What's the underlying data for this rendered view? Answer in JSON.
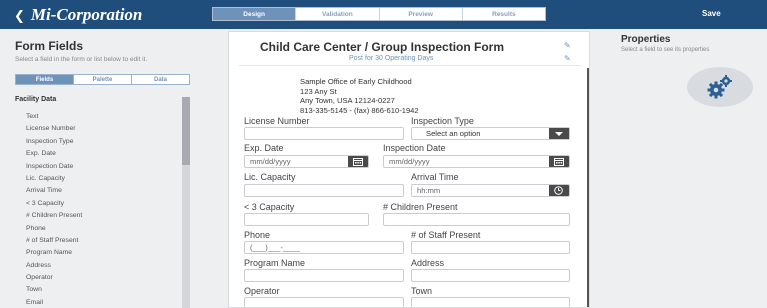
{
  "header": {
    "back_icon": "chevron-left-icon",
    "brand": "Mi-Corporation",
    "steps": [
      "Design",
      "Validation",
      "Preview",
      "Results"
    ],
    "active_step": "Design",
    "save_label": "Save"
  },
  "left_panel": {
    "title": "Form Fields",
    "hint": "Select a field in the form or list below to edit it.",
    "tabs": [
      "Fields",
      "Palette",
      "Data"
    ],
    "active_tab": "Fields",
    "group_title": "Facility Data",
    "fields": [
      "Text",
      "License Number",
      "Inspection Type",
      "Exp. Date",
      "Inspection Date",
      "Lic. Capacity",
      "Arrival Time",
      "< 3 Capacity",
      "# Children Present",
      "Phone",
      "# of Staff Present",
      "Program Name",
      "Address",
      "Operator",
      "Town",
      "Email"
    ]
  },
  "form": {
    "title": "Child Care Center / Group Inspection Form",
    "subtitle": "Post for 30 Operating Days",
    "address_lines": [
      "Sample Office of Early Childhood",
      "123 Any St",
      "Any Town, USA 12124-0227",
      "813-335-5145 - (fax) 866-610-1942"
    ],
    "license_number": {
      "label": "License Number",
      "value": ""
    },
    "inspection_type": {
      "label": "Inspection Type",
      "value": "Select an option"
    },
    "exp_date": {
      "label": "Exp. Date",
      "placeholder": "mm/dd/yyyy"
    },
    "inspection_date": {
      "label": "Inspection Date",
      "placeholder": "mm/dd/yyyy"
    },
    "lic_capacity": {
      "label": "Lic. Capacity",
      "value": ""
    },
    "arrival_time": {
      "label": "Arrival Time",
      "placeholder": "hh:mm"
    },
    "under3_capacity": {
      "label": "< 3 Capacity",
      "value": ""
    },
    "children_present": {
      "label": "# Children Present",
      "value": ""
    },
    "phone": {
      "label": "Phone",
      "placeholder": "(___)___-____"
    },
    "staff_present": {
      "label": "# of Staff Present",
      "value": ""
    },
    "program_name": {
      "label": "Program Name",
      "value": ""
    },
    "address": {
      "label": "Address",
      "value": ""
    },
    "operator": {
      "label": "Operator",
      "value": ""
    },
    "town": {
      "label": "Town",
      "value": ""
    }
  },
  "right_panel": {
    "title": "Properties",
    "hint": "Select a field to see its properties",
    "icon": "gears-icon"
  },
  "colors": {
    "header_bg": "#1f4e7d",
    "accent": "#6f92bb",
    "button_dark": "#4a4a4a"
  }
}
